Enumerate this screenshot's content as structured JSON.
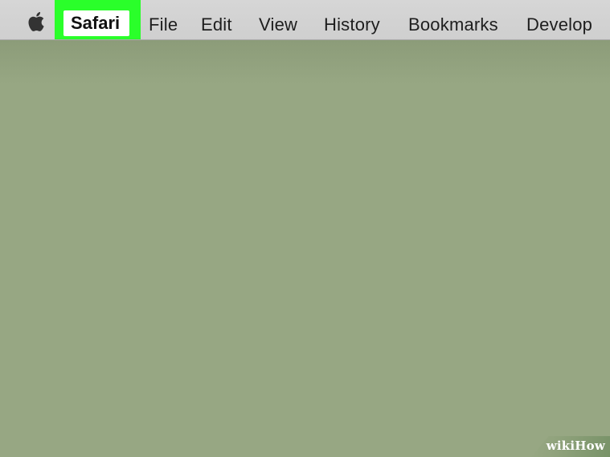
{
  "menubar": {
    "apple_icon": "apple-logo-icon",
    "items": [
      {
        "label": "Safari",
        "highlighted": true
      },
      {
        "label": "File"
      },
      {
        "label": "Edit"
      },
      {
        "label": "View"
      },
      {
        "label": "History"
      },
      {
        "label": "Bookmarks"
      },
      {
        "label": "Develop"
      }
    ]
  },
  "colors": {
    "desktop": "#97a783",
    "menubar": "#d3d3d3",
    "highlight": "#2aff2a"
  },
  "watermark": {
    "text": "wikiHow"
  }
}
